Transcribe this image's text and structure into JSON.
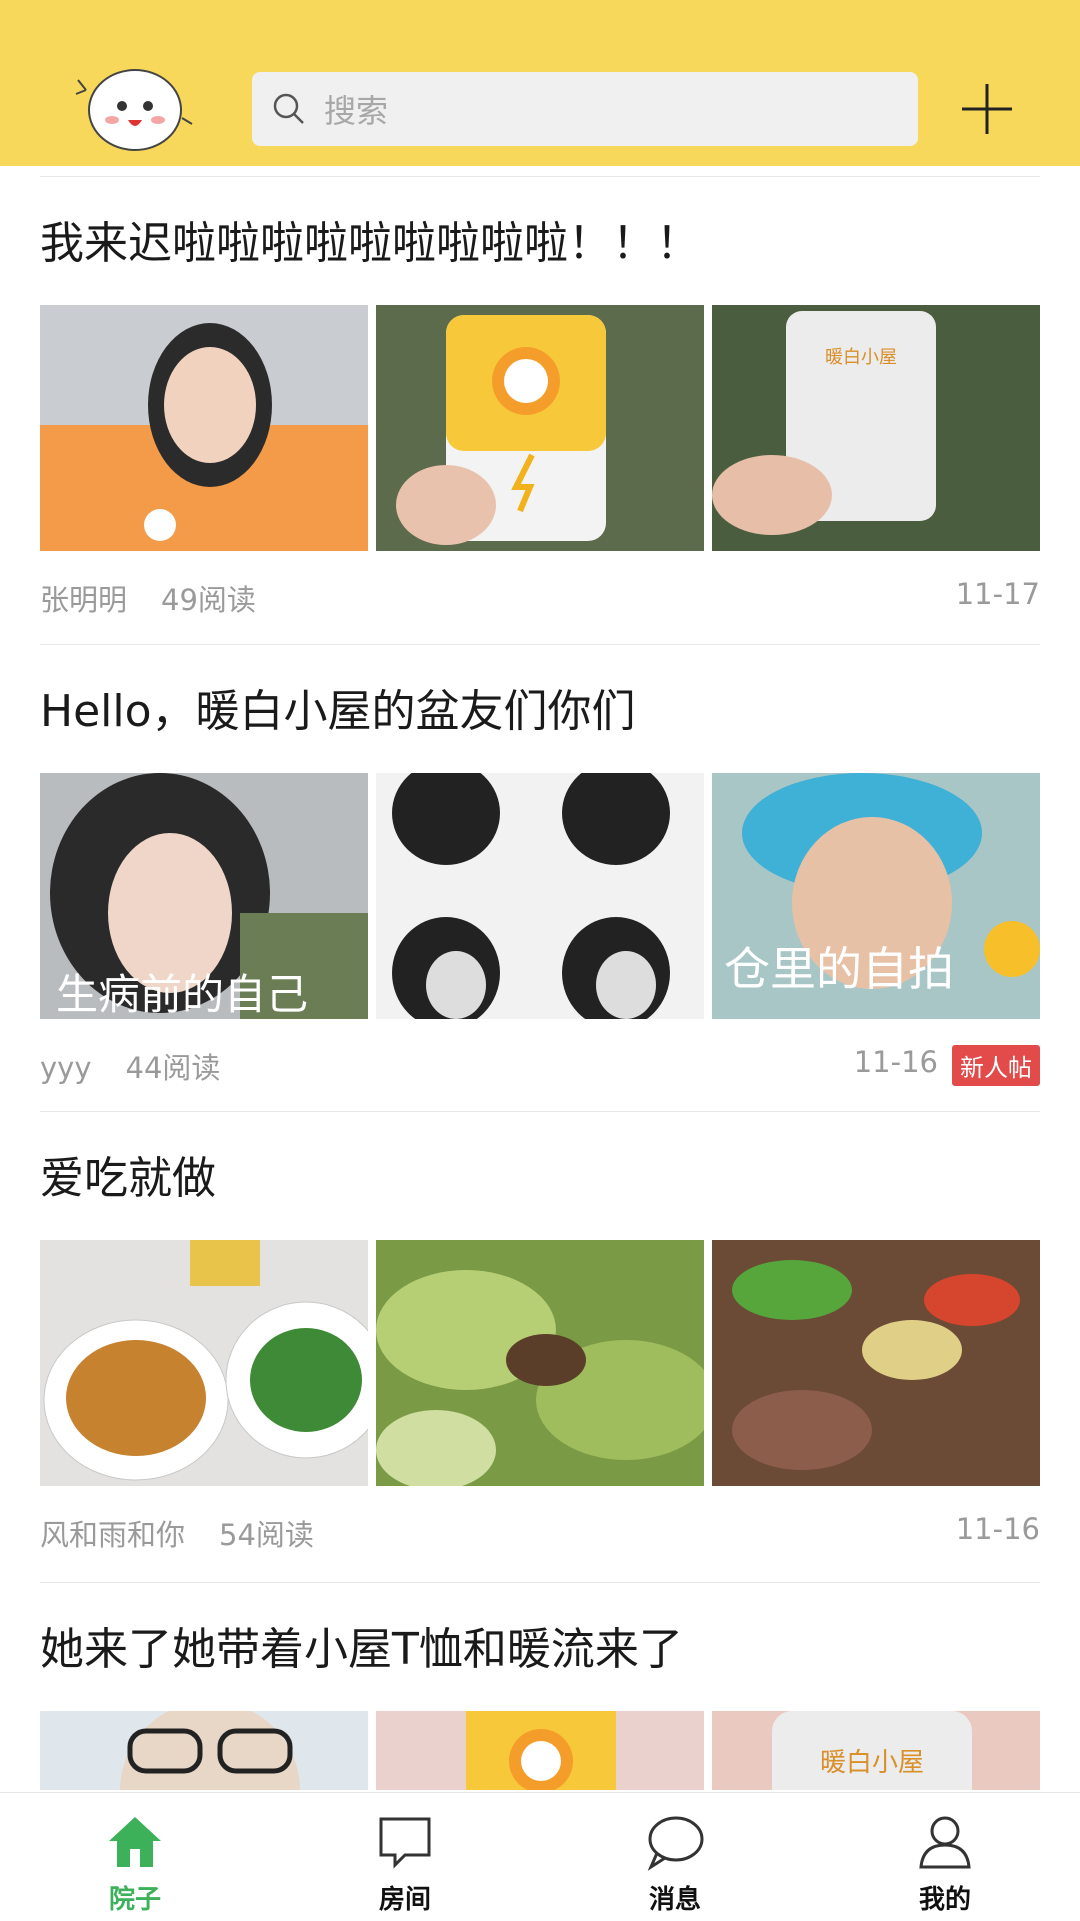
{
  "header": {
    "search_placeholder": "搜索",
    "brand_color": "#f7d85a"
  },
  "posts": [
    {
      "title": "我来迟啦啦啦啦啦啦啦啦啦！！！",
      "author": "张明明",
      "reads": "49阅读",
      "date": "11-17",
      "badge": ""
    },
    {
      "title": "Hello，暖白小屋的盆友们你们",
      "author": "yyy",
      "reads": "44阅读",
      "date": "11-16",
      "badge": "新人帖",
      "image_captions": [
        "生病前的自己",
        "",
        "仓里的自拍"
      ]
    },
    {
      "title": "爱吃就做",
      "author": "风和雨和你",
      "reads": "54阅读",
      "date": "11-16",
      "badge": ""
    },
    {
      "title": "她来了她带着小屋T恤和暖流来了"
    }
  ],
  "tabs": [
    {
      "label": "院子",
      "icon": "home-icon",
      "active": true
    },
    {
      "label": "房间",
      "icon": "chat-square-icon",
      "active": false
    },
    {
      "label": "消息",
      "icon": "chat-bubble-icon",
      "active": false
    },
    {
      "label": "我的",
      "icon": "person-icon",
      "active": false
    }
  ],
  "colors": {
    "accent": "#3cb15a",
    "badge": "#e34b4b"
  }
}
